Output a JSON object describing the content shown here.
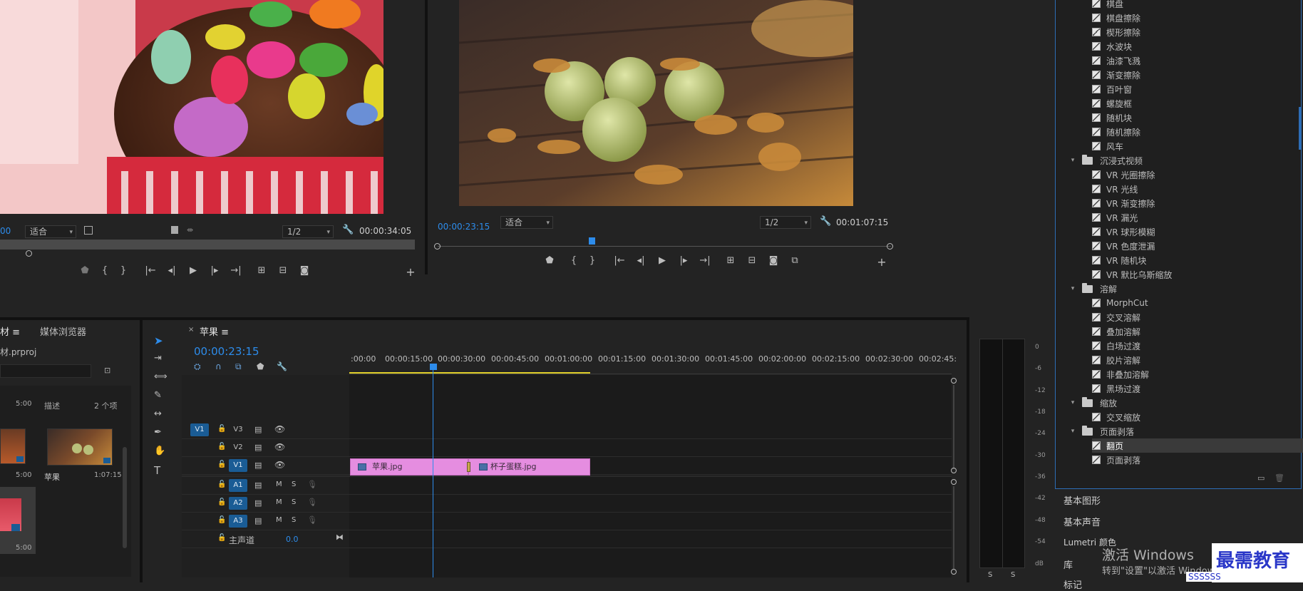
{
  "source_monitor": {
    "timecode_left": "00",
    "fit_label": "适合",
    "resolution": "1/2",
    "duration": "00:00:34:05"
  },
  "program_monitor": {
    "timecode": "00:00:23:15",
    "fit_label": "适合",
    "resolution": "1/2",
    "duration": "00:01:07:15"
  },
  "project_panel": {
    "tab_project": "材",
    "tab_media_browser": "媒体浏览器",
    "file_name": "材.prproj",
    "header_name": "描述",
    "header_count": "2 个项",
    "item1_duration": "5:00",
    "item2_duration": "5:00",
    "item3_name": "苹果",
    "item3_duration": "1:07:15",
    "item4_duration": "5:00"
  },
  "timeline": {
    "tab_name": "苹果",
    "timecode": "00:00:23:15",
    "ruler_labels": [
      ":00:00",
      "00:00:15:00",
      "00:00:30:00",
      "00:00:45:00",
      "00:01:00:00",
      "00:01:15:00",
      "00:01:30:00",
      "00:01:45:00",
      "00:02:00:00",
      "00:02:15:00",
      "00:02:30:00",
      "00:02:45:"
    ],
    "source_patch": "V1",
    "tracks_video": [
      "V3",
      "V2",
      "V1"
    ],
    "tracks_audio": [
      "A1",
      "A2",
      "A3"
    ],
    "master_label": "主声道",
    "master_value": "0.0",
    "audio_m": "M",
    "audio_s": "S",
    "clips": [
      {
        "name": "苹果.jpg"
      },
      {
        "name": "杯子蛋糕.jpg"
      }
    ]
  },
  "audio_meter": {
    "labels": [
      "0",
      "-6",
      "-12",
      "-18",
      "-24",
      "-30",
      "-36",
      "-42",
      "-48",
      "-54",
      "dB"
    ],
    "solo_left": "S",
    "solo_right": "S"
  },
  "effects_panel": {
    "items": [
      {
        "type": "fx",
        "label": "棋盘"
      },
      {
        "type": "fx",
        "label": "棋盘擦除"
      },
      {
        "type": "fx",
        "label": "楔形擦除"
      },
      {
        "type": "fx",
        "label": "水波块"
      },
      {
        "type": "fx",
        "label": "油漆飞溅"
      },
      {
        "type": "fx",
        "label": "渐变擦除"
      },
      {
        "type": "fx",
        "label": "百叶窗"
      },
      {
        "type": "fx",
        "label": "螺旋框"
      },
      {
        "type": "fx",
        "label": "随机块"
      },
      {
        "type": "fx",
        "label": "随机擦除"
      },
      {
        "type": "fx",
        "label": "风车"
      },
      {
        "type": "folder",
        "label": "沉浸式视频"
      },
      {
        "type": "fx",
        "label": "VR 光圈擦除"
      },
      {
        "type": "fx",
        "label": "VR 光线"
      },
      {
        "type": "fx",
        "label": "VR 渐变擦除"
      },
      {
        "type": "fx",
        "label": "VR 漏光"
      },
      {
        "type": "fx",
        "label": "VR 球形模糊"
      },
      {
        "type": "fx",
        "label": "VR 色度泄漏"
      },
      {
        "type": "fx",
        "label": "VR 随机块"
      },
      {
        "type": "fx",
        "label": "VR 默比乌斯缩放"
      },
      {
        "type": "folder",
        "label": "溶解"
      },
      {
        "type": "fx",
        "label": "MorphCut"
      },
      {
        "type": "fx",
        "label": "交叉溶解"
      },
      {
        "type": "fx",
        "label": "叠加溶解"
      },
      {
        "type": "fx",
        "label": "白场过渡"
      },
      {
        "type": "fx",
        "label": "胶片溶解"
      },
      {
        "type": "fx",
        "label": "非叠加溶解"
      },
      {
        "type": "fx",
        "label": "黑场过渡"
      },
      {
        "type": "folder",
        "label": "缩放"
      },
      {
        "type": "fx",
        "label": "交叉缩放"
      },
      {
        "type": "folder",
        "label": "页面剥落"
      },
      {
        "type": "fx",
        "label": "翻页",
        "selected": true
      },
      {
        "type": "fx",
        "label": "页面剥落"
      }
    ],
    "links": [
      "基本图形",
      "基本声音",
      "Lumetri 颜色",
      "库",
      "标记"
    ]
  },
  "overlay": {
    "windows_title": "激活 Windows",
    "windows_sub": "转到\"设置\"以激活 Windows",
    "watermark": "最需教育",
    "watermark_url": "SSSSSS"
  },
  "colors": {
    "accent": "#2d8ceb",
    "clip": "#e58de0",
    "track_on": "#1a5c95"
  }
}
